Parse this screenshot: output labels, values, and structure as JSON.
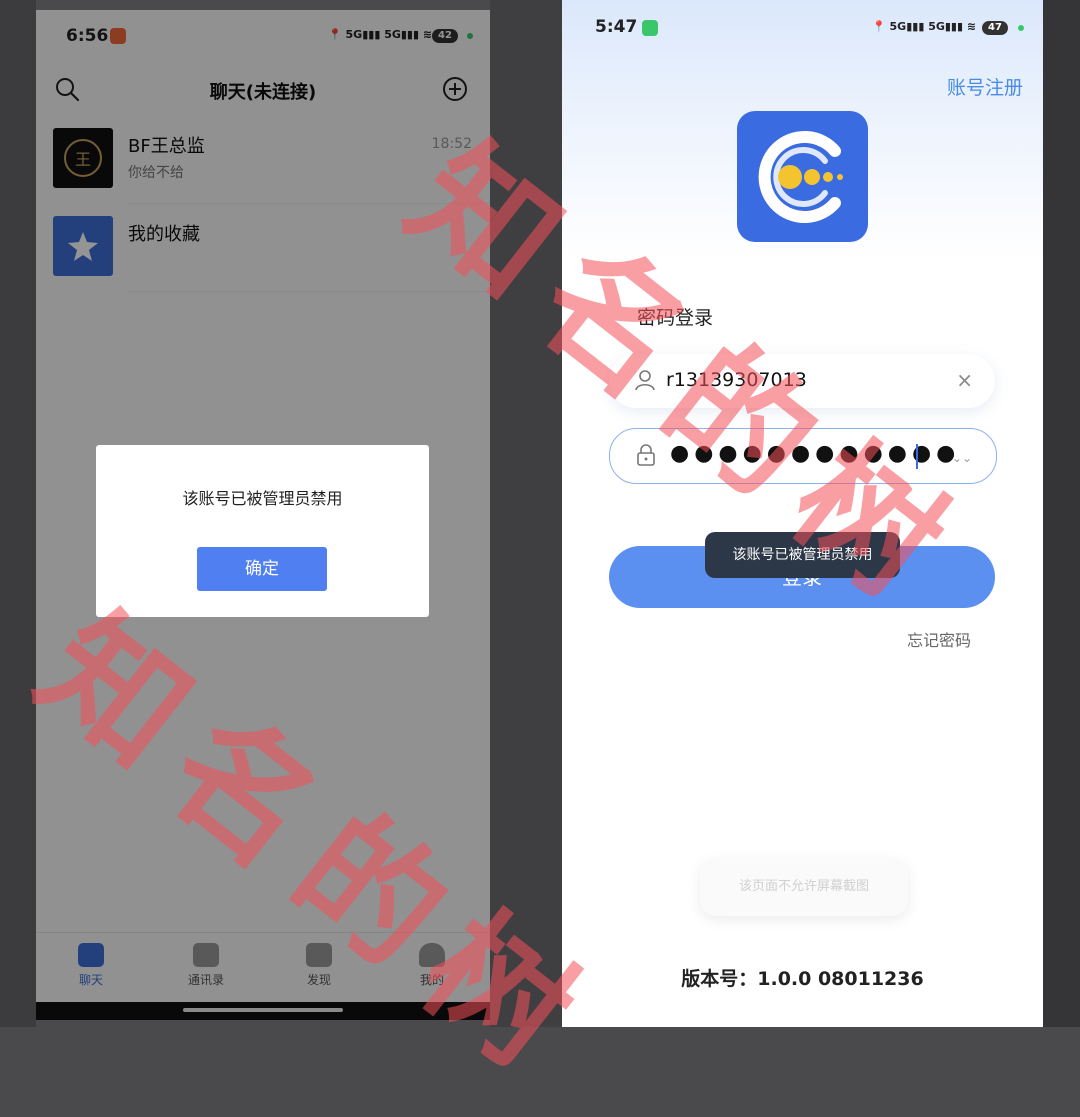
{
  "left_phone": {
    "status_time": "6:56",
    "battery": "42",
    "title": "聊天(未连接)",
    "chats": [
      {
        "name": "BF王总监",
        "message": "你给不给",
        "time": "18:52"
      },
      {
        "name": "我的收藏",
        "message": "",
        "time": ""
      }
    ],
    "tabs": [
      {
        "label": "聊天"
      },
      {
        "label": "通讯录"
      },
      {
        "label": "发现"
      },
      {
        "label": "我的"
      }
    ],
    "dialog": {
      "message": "该账号已被管理员禁用",
      "confirm_label": "确定"
    },
    "colors": {
      "accent": "#4f7ff0"
    }
  },
  "right_phone": {
    "status_time": "5:47",
    "battery": "47",
    "register_link": "账号注册",
    "login_title": "密码登录",
    "username_value": "r13139307013",
    "password_masked": "●●●●●●●●●●●●",
    "login_button": "登录",
    "toast": "该账号已被管理员禁用",
    "forgot_password": "忘记密码",
    "screenshot_notice": "该页面不允许屏幕截图",
    "version": "版本号：1.0.0 08011236",
    "colors": {
      "primary": "#5b8ff0",
      "logo": "#3a6be0",
      "link": "#4a8be8"
    }
  },
  "watermark": "知名的树"
}
